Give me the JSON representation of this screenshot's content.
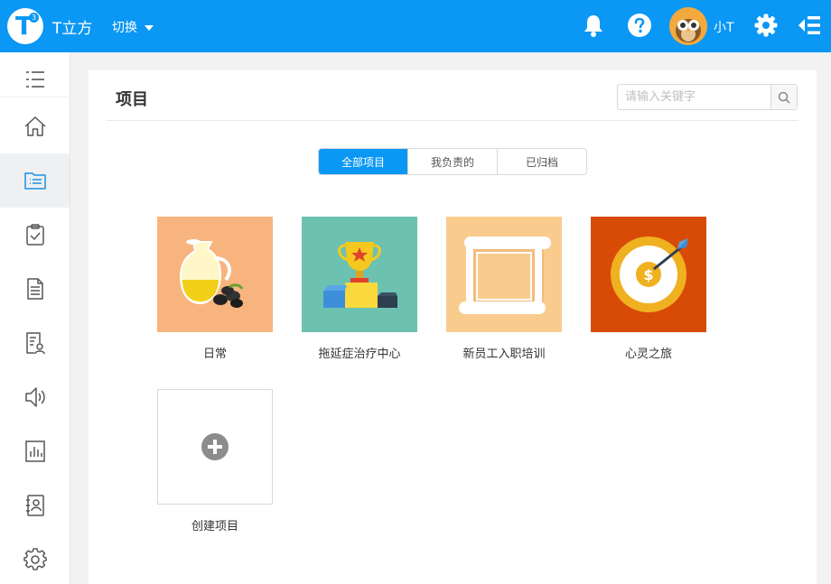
{
  "header": {
    "logo_letter": "T",
    "logo_sup": "3",
    "app_name": "T立方",
    "switch_label": "切换",
    "username": "小T",
    "icons": [
      "bell-icon",
      "help-icon",
      "settings-icon",
      "collapse-menu-icon"
    ]
  },
  "sidebar": {
    "items": [
      {
        "icon": "menu-icon",
        "active": false
      },
      {
        "icon": "home-icon",
        "active": false
      },
      {
        "icon": "project-list-icon",
        "active": true
      },
      {
        "icon": "clipboard-check-icon",
        "active": false
      },
      {
        "icon": "document-icon",
        "active": false
      },
      {
        "icon": "contact-document-icon",
        "active": false
      },
      {
        "icon": "speaker-icon",
        "active": false
      },
      {
        "icon": "bar-chart-icon",
        "active": false
      },
      {
        "icon": "address-book-icon",
        "active": false
      },
      {
        "icon": "gear-icon",
        "active": false
      }
    ]
  },
  "main": {
    "title": "项目",
    "search": {
      "placeholder": "请输入关键字",
      "value": ""
    },
    "tabs": [
      {
        "label": "全部项目",
        "active": true
      },
      {
        "label": "我负责的",
        "active": false
      },
      {
        "label": "已归档",
        "active": false
      }
    ],
    "projects": [
      {
        "name": "日常",
        "icon": "oil-jug-icon",
        "bg": "#f8b47e"
      },
      {
        "name": "拖延症治疗中心",
        "icon": "trophy-podium-icon",
        "bg": "#6cc1b0"
      },
      {
        "name": "新员工入职培训",
        "icon": "scroll-icon",
        "bg": "#f9cc8e"
      },
      {
        "name": "心灵之旅",
        "icon": "target-arrow-icon",
        "bg": "#d84b07"
      }
    ],
    "create_label": "创建项目"
  },
  "colors": {
    "accent": "#0b97f4",
    "sidebar_active": "#eef0f2"
  }
}
